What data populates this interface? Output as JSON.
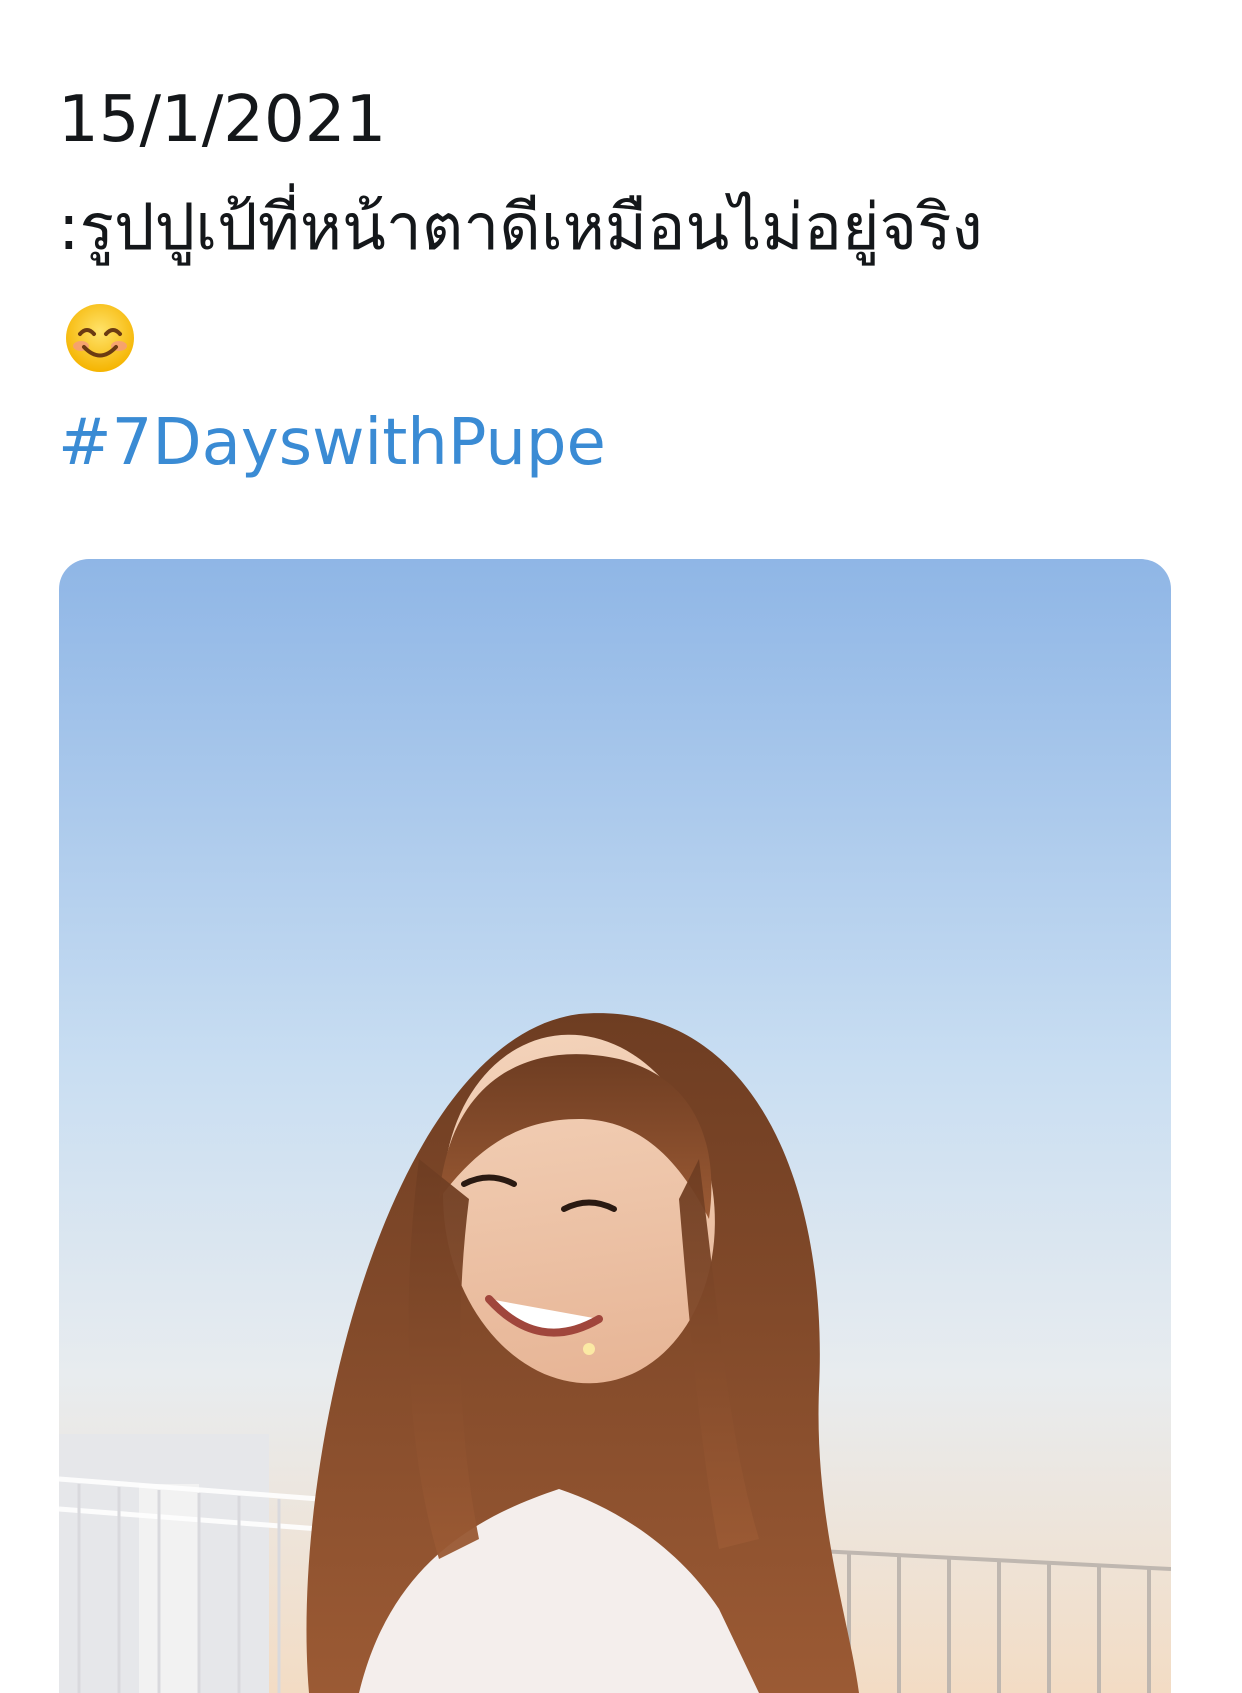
{
  "tweet": {
    "date": "15/1/2021",
    "text": ":รูปปูเป้ที่หน้าตาดีเหมือนไม่อยู่จริง",
    "emoji": "smiling-face-with-smiling-eyes",
    "hashtag": "#7DayswithPupe"
  },
  "colors": {
    "text": "#14171a",
    "link": "#3a8bd4",
    "sky_top": "#8fb6e6",
    "sky_bottom": "#f3dcc4"
  }
}
